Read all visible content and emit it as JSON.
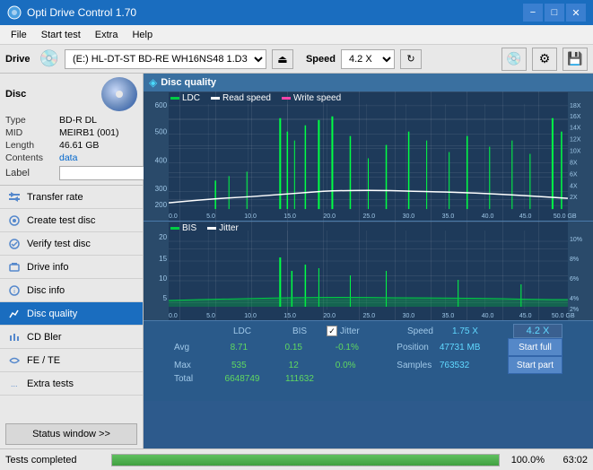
{
  "titleBar": {
    "title": "Opti Drive Control 1.70",
    "minimizeLabel": "−",
    "maximizeLabel": "□",
    "closeLabel": "✕"
  },
  "menuBar": {
    "items": [
      "File",
      "Start test",
      "Extra",
      "Help"
    ]
  },
  "driveBar": {
    "driveLabel": "Drive",
    "driveValue": "(E:)  HL-DT-ST BD-RE  WH16NS48 1.D3",
    "speedLabel": "Speed",
    "speedValue": "4.2 X"
  },
  "disc": {
    "sectionTitle": "Disc",
    "typeLabel": "Type",
    "typeValue": "BD-R DL",
    "midLabel": "MID",
    "midValue": "MEIRB1 (001)",
    "lengthLabel": "Length",
    "lengthValue": "46.61 GB",
    "contentsLabel": "Contents",
    "contentsValue": "data",
    "labelLabel": "Label",
    "labelValue": ""
  },
  "navigation": {
    "items": [
      {
        "id": "transfer-rate",
        "label": "Transfer rate",
        "icon": "▶"
      },
      {
        "id": "create-test-disc",
        "label": "Create test disc",
        "icon": "▶"
      },
      {
        "id": "verify-test-disc",
        "label": "Verify test disc",
        "icon": "▶"
      },
      {
        "id": "drive-info",
        "label": "Drive info",
        "icon": "▶"
      },
      {
        "id": "disc-info",
        "label": "Disc info",
        "icon": "▶"
      },
      {
        "id": "disc-quality",
        "label": "Disc quality",
        "icon": "▶",
        "active": true
      },
      {
        "id": "cd-bler",
        "label": "CD Bler",
        "icon": "▶"
      },
      {
        "id": "fe-te",
        "label": "FE / TE",
        "icon": "▶"
      },
      {
        "id": "extra-tests",
        "label": "Extra tests",
        "icon": "▶"
      }
    ]
  },
  "statusWindow": {
    "label": "Status window >>"
  },
  "chartHeader": {
    "title": "Disc quality"
  },
  "topChart": {
    "legend": [
      {
        "label": "LDC",
        "color": "#00cc44"
      },
      {
        "label": "Read speed",
        "color": "#ffffff"
      },
      {
        "label": "Write speed",
        "color": "#ff44aa"
      }
    ],
    "yAxisMax": "600",
    "yAxisRight": [
      "18X",
      "16X",
      "14X",
      "12X",
      "10X",
      "8X",
      "6X",
      "4X",
      "2X"
    ],
    "xAxis": [
      "0.0",
      "5.0",
      "10.0",
      "15.0",
      "20.0",
      "25.0",
      "30.0",
      "35.0",
      "40.0",
      "45.0",
      "50.0 GB"
    ]
  },
  "bottomChart": {
    "legend": [
      {
        "label": "BIS",
        "color": "#00cc44"
      },
      {
        "label": "Jitter",
        "color": "#ffffff"
      }
    ],
    "yAxisRight": [
      "10%",
      "8%",
      "6%",
      "4%",
      "2%"
    ],
    "yAxisLeft": [
      "20",
      "15",
      "10",
      "5"
    ],
    "xAxis": [
      "0.0",
      "5.0",
      "10.0",
      "15.0",
      "20.0",
      "25.0",
      "30.0",
      "35.0",
      "40.0",
      "45.0",
      "50.0 GB"
    ]
  },
  "stats": {
    "headers": {
      "ldc": "LDC",
      "bis": "BIS",
      "jitter": "Jitter",
      "speed": "Speed",
      "speedVal": "1.75 X"
    },
    "rows": [
      {
        "label": "Avg",
        "ldc": "8.71",
        "bis": "0.15",
        "jitter": "-0.1%"
      },
      {
        "label": "Max",
        "ldc": "535",
        "bis": "12",
        "jitter": "0.0%"
      },
      {
        "label": "Total",
        "ldc": "6648749",
        "bis": "111632",
        "jitter": ""
      }
    ],
    "position": {
      "label": "Position",
      "value": "47731 MB"
    },
    "samples": {
      "label": "Samples",
      "value": "763532"
    },
    "startFull": "Start full",
    "startPart": "Start part",
    "speedDisplay": "4.2 X",
    "jitterChecked": true
  },
  "progressBar": {
    "statusText": "Tests completed",
    "fillPercent": 100,
    "percentText": "100.0%",
    "timeText": "63:02"
  }
}
